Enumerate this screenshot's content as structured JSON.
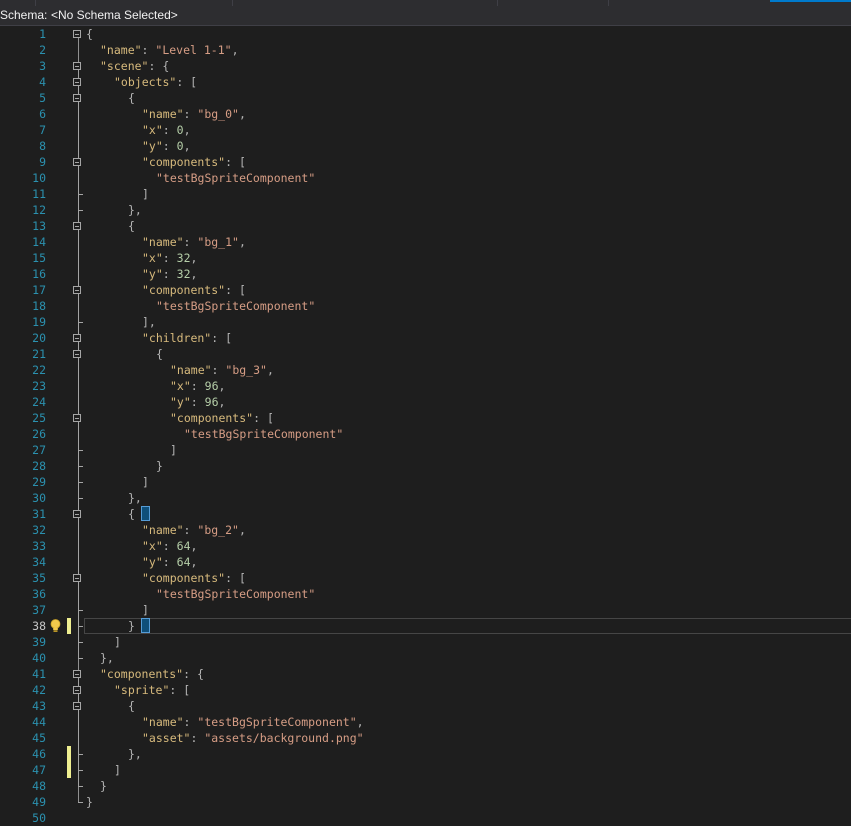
{
  "schema_bar": {
    "label": "Schema:",
    "value": "<No Schema Selected>"
  },
  "editor": {
    "current_line": 38,
    "colors": {
      "line_number": "#2b91af",
      "key": "#d7ba7d",
      "string": "#d69d85",
      "number": "#b5cea8",
      "punctuation": "#b4b4b4",
      "change_marker": "#efef91",
      "brace_match": "#569cd6"
    },
    "lines": [
      [
        {
          "t": "{",
          "c": "p"
        }
      ],
      [
        {
          "t": "\"name\"",
          "c": "k"
        },
        {
          "t": ": ",
          "c": "p"
        },
        {
          "t": "\"Level 1-1\"",
          "c": "s"
        },
        {
          "t": ",",
          "c": "p"
        }
      ],
      [
        {
          "t": "\"scene\"",
          "c": "k"
        },
        {
          "t": ": {",
          "c": "p"
        }
      ],
      [
        {
          "t": "\"objects\"",
          "c": "k"
        },
        {
          "t": ": [",
          "c": "p"
        }
      ],
      [
        {
          "t": "{",
          "c": "p"
        }
      ],
      [
        {
          "t": "\"name\"",
          "c": "k"
        },
        {
          "t": ": ",
          "c": "p"
        },
        {
          "t": "\"bg_0\"",
          "c": "s"
        },
        {
          "t": ",",
          "c": "p"
        }
      ],
      [
        {
          "t": "\"x\"",
          "c": "k"
        },
        {
          "t": ": ",
          "c": "p"
        },
        {
          "t": "0",
          "c": "n"
        },
        {
          "t": ",",
          "c": "p"
        }
      ],
      [
        {
          "t": "\"y\"",
          "c": "k"
        },
        {
          "t": ": ",
          "c": "p"
        },
        {
          "t": "0",
          "c": "n"
        },
        {
          "t": ",",
          "c": "p"
        }
      ],
      [
        {
          "t": "\"components\"",
          "c": "k"
        },
        {
          "t": ": [",
          "c": "p"
        }
      ],
      [
        {
          "t": "\"testBgSpriteComponent\"",
          "c": "s"
        }
      ],
      [
        {
          "t": "]",
          "c": "p"
        }
      ],
      [
        {
          "t": "},",
          "c": "p"
        }
      ],
      [
        {
          "t": "{",
          "c": "p"
        }
      ],
      [
        {
          "t": "\"name\"",
          "c": "k"
        },
        {
          "t": ": ",
          "c": "p"
        },
        {
          "t": "\"bg_1\"",
          "c": "s"
        },
        {
          "t": ",",
          "c": "p"
        }
      ],
      [
        {
          "t": "\"x\"",
          "c": "k"
        },
        {
          "t": ": ",
          "c": "p"
        },
        {
          "t": "32",
          "c": "n"
        },
        {
          "t": ",",
          "c": "p"
        }
      ],
      [
        {
          "t": "\"y\"",
          "c": "k"
        },
        {
          "t": ": ",
          "c": "p"
        },
        {
          "t": "32",
          "c": "n"
        },
        {
          "t": ",",
          "c": "p"
        }
      ],
      [
        {
          "t": "\"components\"",
          "c": "k"
        },
        {
          "t": ": [",
          "c": "p"
        }
      ],
      [
        {
          "t": "\"testBgSpriteComponent\"",
          "c": "s"
        }
      ],
      [
        {
          "t": "],",
          "c": "p"
        }
      ],
      [
        {
          "t": "\"children\"",
          "c": "k"
        },
        {
          "t": ": [",
          "c": "p"
        }
      ],
      [
        {
          "t": "{",
          "c": "p"
        }
      ],
      [
        {
          "t": "\"name\"",
          "c": "k"
        },
        {
          "t": ": ",
          "c": "p"
        },
        {
          "t": "\"bg_3\"",
          "c": "s"
        },
        {
          "t": ",",
          "c": "p"
        }
      ],
      [
        {
          "t": "\"x\"",
          "c": "k"
        },
        {
          "t": ": ",
          "c": "p"
        },
        {
          "t": "96",
          "c": "n"
        },
        {
          "t": ",",
          "c": "p"
        }
      ],
      [
        {
          "t": "\"y\"",
          "c": "k"
        },
        {
          "t": ": ",
          "c": "p"
        },
        {
          "t": "96",
          "c": "n"
        },
        {
          "t": ",",
          "c": "p"
        }
      ],
      [
        {
          "t": "\"components\"",
          "c": "k"
        },
        {
          "t": ": [",
          "c": "p"
        }
      ],
      [
        {
          "t": "\"testBgSpriteComponent\"",
          "c": "s"
        }
      ],
      [
        {
          "t": "]",
          "c": "p"
        }
      ],
      [
        {
          "t": "}",
          "c": "p"
        }
      ],
      [
        {
          "t": "]",
          "c": "p"
        }
      ],
      [
        {
          "t": "},",
          "c": "p"
        }
      ],
      [
        {
          "t": "{",
          "c": "p"
        }
      ],
      [
        {
          "t": "\"name\"",
          "c": "k"
        },
        {
          "t": ": ",
          "c": "p"
        },
        {
          "t": "\"bg_2\"",
          "c": "s"
        },
        {
          "t": ",",
          "c": "p"
        }
      ],
      [
        {
          "t": "\"x\"",
          "c": "k"
        },
        {
          "t": ": ",
          "c": "p"
        },
        {
          "t": "64",
          "c": "n"
        },
        {
          "t": ",",
          "c": "p"
        }
      ],
      [
        {
          "t": "\"y\"",
          "c": "k"
        },
        {
          "t": ": ",
          "c": "p"
        },
        {
          "t": "64",
          "c": "n"
        },
        {
          "t": ",",
          "c": "p"
        }
      ],
      [
        {
          "t": "\"components\"",
          "c": "k"
        },
        {
          "t": ": [",
          "c": "p"
        }
      ],
      [
        {
          "t": "\"testBgSpriteComponent\"",
          "c": "s"
        }
      ],
      [
        {
          "t": "]",
          "c": "p"
        }
      ],
      [
        {
          "t": "}",
          "c": "p"
        }
      ],
      [
        {
          "t": "]",
          "c": "p"
        }
      ],
      [
        {
          "t": "},",
          "c": "p"
        }
      ],
      [
        {
          "t": "\"components\"",
          "c": "k"
        },
        {
          "t": ": {",
          "c": "p"
        }
      ],
      [
        {
          "t": "\"sprite\"",
          "c": "k"
        },
        {
          "t": ": [",
          "c": "p"
        }
      ],
      [
        {
          "t": "{",
          "c": "p"
        }
      ],
      [
        {
          "t": "\"name\"",
          "c": "k"
        },
        {
          "t": ": ",
          "c": "p"
        },
        {
          "t": "\"testBgSpriteComponent\"",
          "c": "s"
        },
        {
          "t": ",",
          "c": "p"
        }
      ],
      [
        {
          "t": "\"asset\"",
          "c": "k"
        },
        {
          "t": ": ",
          "c": "p"
        },
        {
          "t": "\"assets/background.png\"",
          "c": "s"
        }
      ],
      [
        {
          "t": "},",
          "c": "p"
        }
      ],
      [
        {
          "t": "]",
          "c": "p"
        }
      ],
      [
        {
          "t": "}",
          "c": "p"
        }
      ],
      [
        {
          "t": "}",
          "c": "p"
        }
      ],
      []
    ],
    "fold_markers": [
      1,
      3,
      4,
      5,
      9,
      13,
      17,
      20,
      21,
      25,
      31,
      35,
      41,
      42,
      43
    ],
    "change_markers": [
      38,
      46,
      47
    ],
    "lightbulb_line": 38,
    "lightbulb_icon": "lightbulb-icon"
  }
}
